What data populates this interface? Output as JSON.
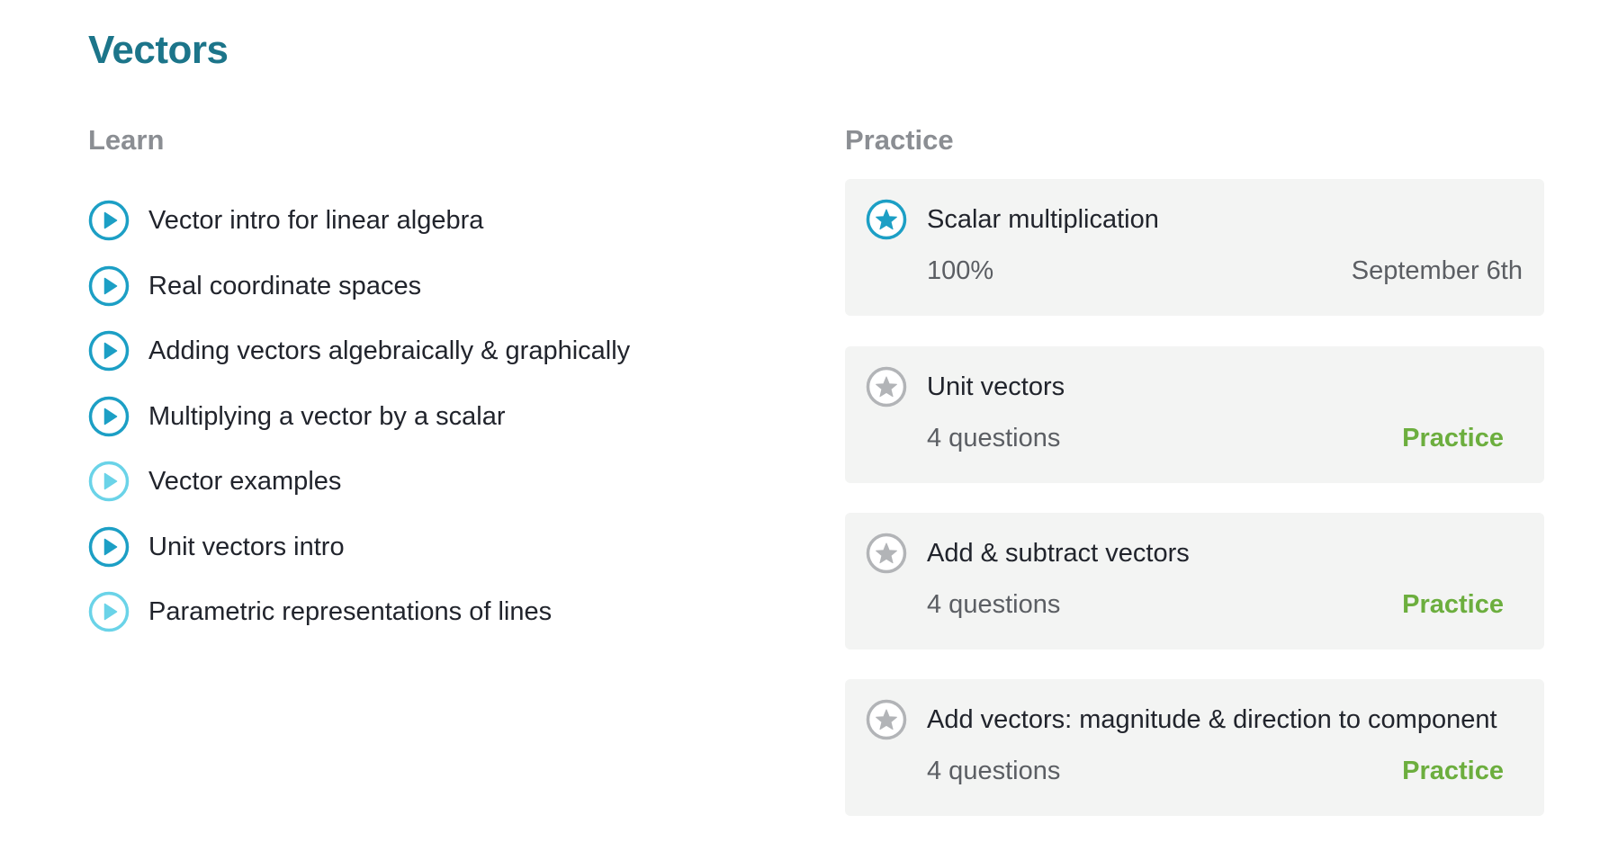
{
  "page_title": "Vectors",
  "learn": {
    "heading": "Learn",
    "items": [
      {
        "label": "Vector intro for linear algebra",
        "icon": "play-circle-icon",
        "state": "watched"
      },
      {
        "label": "Real coordinate spaces",
        "icon": "play-circle-icon",
        "state": "watched"
      },
      {
        "label": "Adding vectors algebraically & graphically",
        "icon": "play-circle-icon",
        "state": "watched"
      },
      {
        "label": "Multiplying a vector by a scalar",
        "icon": "play-circle-icon",
        "state": "watched"
      },
      {
        "label": "Vector examples",
        "icon": "play-circle-icon",
        "state": "unwatched"
      },
      {
        "label": "Unit vectors intro",
        "icon": "play-circle-icon",
        "state": "watched"
      },
      {
        "label": "Parametric representations of lines",
        "icon": "play-circle-icon",
        "state": "unwatched"
      }
    ]
  },
  "practice": {
    "heading": "Practice",
    "items": [
      {
        "title": "Scalar multiplication",
        "subtitle": "100%",
        "date": "September 6th",
        "icon": "star-circle-icon",
        "state": "completed"
      },
      {
        "title": "Unit vectors",
        "subtitle": "4 questions",
        "action": "Practice",
        "icon": "star-circle-icon",
        "state": "not-started"
      },
      {
        "title": "Add & subtract vectors",
        "subtitle": "4 questions",
        "action": "Practice",
        "icon": "star-circle-icon",
        "state": "not-started"
      },
      {
        "title": "Add vectors: magnitude & direction to component",
        "subtitle": "4 questions",
        "action": "Practice",
        "icon": "star-circle-icon",
        "state": "not-started"
      }
    ]
  },
  "colors": {
    "title": "#1c758a",
    "heading": "#8b8e93",
    "text": "#21242c",
    "subtext": "#5b5e63",
    "play_dark": "#1c9fc5",
    "play_light": "#6ad3e8",
    "star_active": "#1c9fc5",
    "star_inactive": "#b2b4b7",
    "card_bg": "#f3f4f3",
    "practice_link": "#6cae3e"
  }
}
